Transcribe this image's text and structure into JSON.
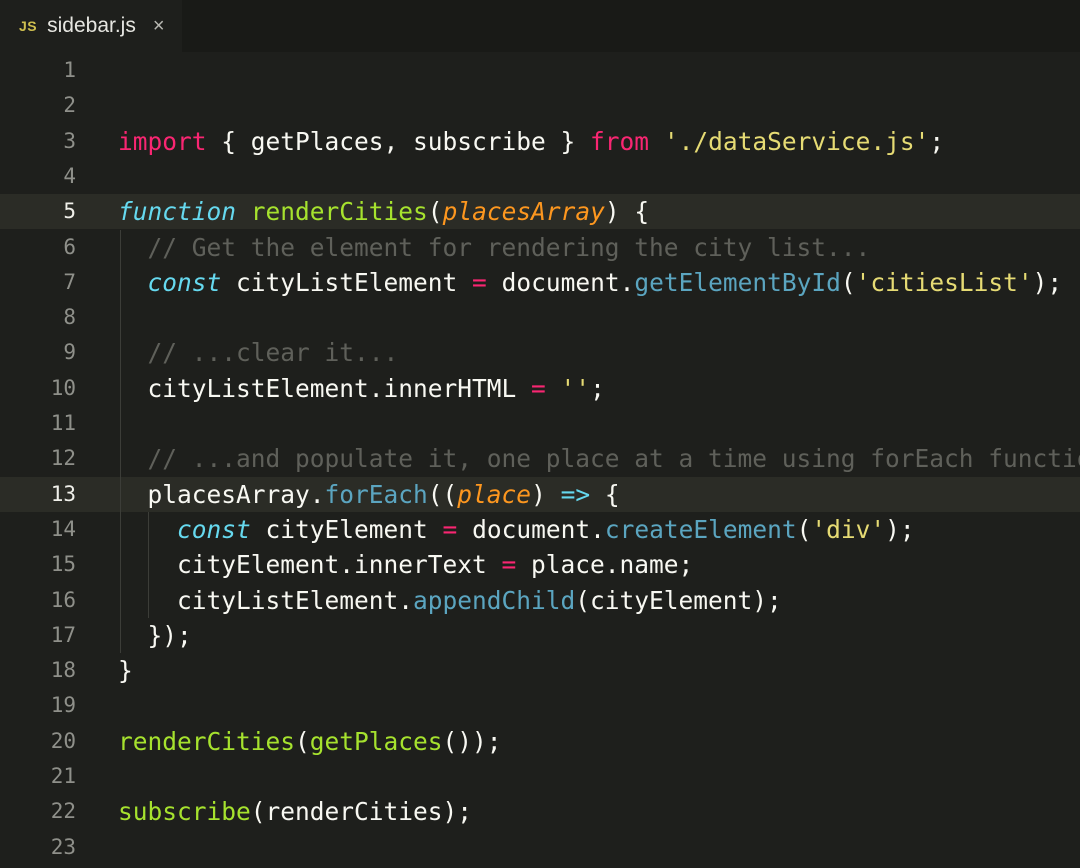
{
  "tab": {
    "icon": "JS",
    "filename": "sidebar.js",
    "close": "×"
  },
  "lines": [
    {
      "n": "1",
      "tokens": []
    },
    {
      "n": "2",
      "tokens": []
    },
    {
      "n": "3",
      "tokens": [
        {
          "t": "kw",
          "v": "import"
        },
        {
          "t": "pl",
          "v": " { getPlaces, subscribe } "
        },
        {
          "t": "kw",
          "v": "from"
        },
        {
          "t": "pl",
          "v": " "
        },
        {
          "t": "st",
          "v": "'./dataService.js'"
        },
        {
          "t": "pl",
          "v": ";"
        }
      ]
    },
    {
      "n": "4",
      "tokens": []
    },
    {
      "n": "5",
      "active": true,
      "tokens": [
        {
          "t": "sf",
          "v": "function"
        },
        {
          "t": "pl",
          "v": " "
        },
        {
          "t": "fn",
          "v": "renderCities"
        },
        {
          "t": "pl",
          "v": "("
        },
        {
          "t": "pa",
          "v": "placesArray"
        },
        {
          "t": "pl",
          "v": ") {"
        }
      ]
    },
    {
      "n": "6",
      "tokens": [
        {
          "t": "pl",
          "v": "  "
        },
        {
          "t": "cm",
          "v": "// Get the element for rendering the city list..."
        }
      ]
    },
    {
      "n": "7",
      "tokens": [
        {
          "t": "pl",
          "v": "  "
        },
        {
          "t": "sf",
          "v": "const"
        },
        {
          "t": "pl",
          "v": " cityListElement "
        },
        {
          "t": "op",
          "v": "="
        },
        {
          "t": "pl",
          "v": " document."
        },
        {
          "t": "mt",
          "v": "getElementById"
        },
        {
          "t": "pl",
          "v": "("
        },
        {
          "t": "st",
          "v": "'citiesList'"
        },
        {
          "t": "pl",
          "v": ");"
        }
      ]
    },
    {
      "n": "8",
      "tokens": []
    },
    {
      "n": "9",
      "tokens": [
        {
          "t": "pl",
          "v": "  "
        },
        {
          "t": "cm",
          "v": "// ...clear it..."
        }
      ]
    },
    {
      "n": "10",
      "tokens": [
        {
          "t": "pl",
          "v": "  cityListElement.innerHTML "
        },
        {
          "t": "op",
          "v": "="
        },
        {
          "t": "pl",
          "v": " "
        },
        {
          "t": "st",
          "v": "''"
        },
        {
          "t": "pl",
          "v": ";"
        }
      ]
    },
    {
      "n": "11",
      "tokens": []
    },
    {
      "n": "12",
      "tokens": [
        {
          "t": "pl",
          "v": "  "
        },
        {
          "t": "cm",
          "v": "// ...and populate it, one place at a time using forEach function"
        }
      ]
    },
    {
      "n": "13",
      "active": true,
      "tokens": [
        {
          "t": "pl",
          "v": "  placesArray."
        },
        {
          "t": "mt",
          "v": "forEach"
        },
        {
          "t": "pl",
          "v": "(("
        },
        {
          "t": "pa",
          "v": "place"
        },
        {
          "t": "pl",
          "v": ") "
        },
        {
          "t": "sf",
          "v": "=>"
        },
        {
          "t": "pl",
          "v": " {"
        }
      ]
    },
    {
      "n": "14",
      "tokens": [
        {
          "t": "pl",
          "v": "    "
        },
        {
          "t": "sf",
          "v": "const"
        },
        {
          "t": "pl",
          "v": " cityElement "
        },
        {
          "t": "op",
          "v": "="
        },
        {
          "t": "pl",
          "v": " document."
        },
        {
          "t": "mt",
          "v": "createElement"
        },
        {
          "t": "pl",
          "v": "("
        },
        {
          "t": "st",
          "v": "'div'"
        },
        {
          "t": "pl",
          "v": ");"
        }
      ]
    },
    {
      "n": "15",
      "tokens": [
        {
          "t": "pl",
          "v": "    cityElement.innerText "
        },
        {
          "t": "op",
          "v": "="
        },
        {
          "t": "pl",
          "v": " place.name;"
        }
      ]
    },
    {
      "n": "16",
      "tokens": [
        {
          "t": "pl",
          "v": "    cityListElement."
        },
        {
          "t": "mt",
          "v": "appendChild"
        },
        {
          "t": "pl",
          "v": "(cityElement);"
        }
      ]
    },
    {
      "n": "17",
      "tokens": [
        {
          "t": "pl",
          "v": "  });"
        }
      ]
    },
    {
      "n": "18",
      "tokens": [
        {
          "t": "pl",
          "v": "}"
        }
      ]
    },
    {
      "n": "19",
      "tokens": []
    },
    {
      "n": "20",
      "tokens": [
        {
          "t": "fn",
          "v": "renderCities"
        },
        {
          "t": "pl",
          "v": "("
        },
        {
          "t": "fn",
          "v": "getPlaces"
        },
        {
          "t": "pl",
          "v": "());"
        }
      ]
    },
    {
      "n": "21",
      "tokens": []
    },
    {
      "n": "22",
      "tokens": [
        {
          "t": "fn",
          "v": "subscribe"
        },
        {
          "t": "pl",
          "v": "(renderCities);"
        }
      ]
    },
    {
      "n": "23",
      "tokens": []
    }
  ]
}
